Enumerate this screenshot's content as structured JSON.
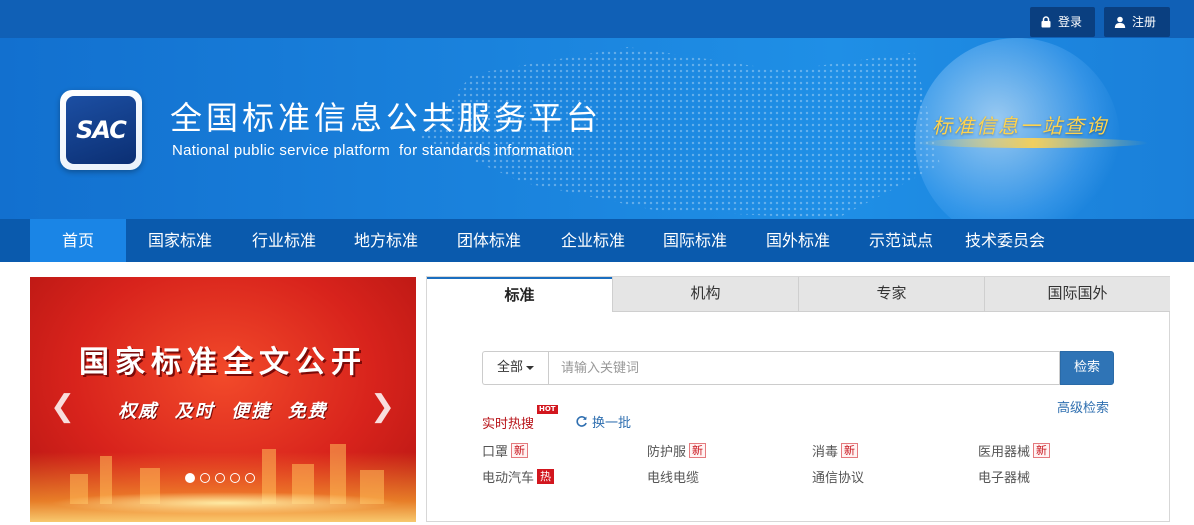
{
  "auth": {
    "login": "登录",
    "register": "注册"
  },
  "brand": {
    "logo_text": "SAC",
    "title": "全国标准信息公共服务平台",
    "subtitle": "National public service platform  for standards information",
    "slogan": "标准信息一站查询"
  },
  "nav": {
    "items": [
      {
        "label": "首页",
        "active": true
      },
      {
        "label": "国家标准"
      },
      {
        "label": "行业标准"
      },
      {
        "label": "地方标准"
      },
      {
        "label": "团体标准"
      },
      {
        "label": "企业标准"
      },
      {
        "label": "国际标准"
      },
      {
        "label": "国外标准"
      },
      {
        "label": "示范试点"
      },
      {
        "label": "技术委员会"
      }
    ]
  },
  "carousel": {
    "title": "国家标准全文公开",
    "subtitle": "权威  及时  便捷  免费",
    "prev": "❮",
    "next": "❯",
    "slide_count": 5,
    "current_slide": 1
  },
  "search": {
    "tabs": [
      {
        "label": "标准",
        "active": true
      },
      {
        "label": "机构"
      },
      {
        "label": "专家"
      },
      {
        "label": "国际国外"
      }
    ],
    "scope": "全部",
    "placeholder": "请输入关键词",
    "button": "检索",
    "advanced": "高级检索",
    "hot_label": "实时热搜",
    "hot_badge": "HOT",
    "refresh": "换一批",
    "keywords": [
      {
        "text": "口罩",
        "tag": "新",
        "tag_type": "new"
      },
      {
        "text": "防护服",
        "tag": "新",
        "tag_type": "new"
      },
      {
        "text": "消毒",
        "tag": "新",
        "tag_type": "new"
      },
      {
        "text": "医用器械",
        "tag": "新",
        "tag_type": "new"
      },
      {
        "text": "电动汽车",
        "tag": "热",
        "tag_type": "hot"
      },
      {
        "text": "电线电缆"
      },
      {
        "text": "通信协议"
      },
      {
        "text": "电子器械"
      }
    ]
  },
  "colors": {
    "primary": "#1060b6",
    "nav": "#0a5aad",
    "nav_active": "#1a85e6",
    "hot": "#d2161e",
    "link": "#2f6fb0"
  }
}
